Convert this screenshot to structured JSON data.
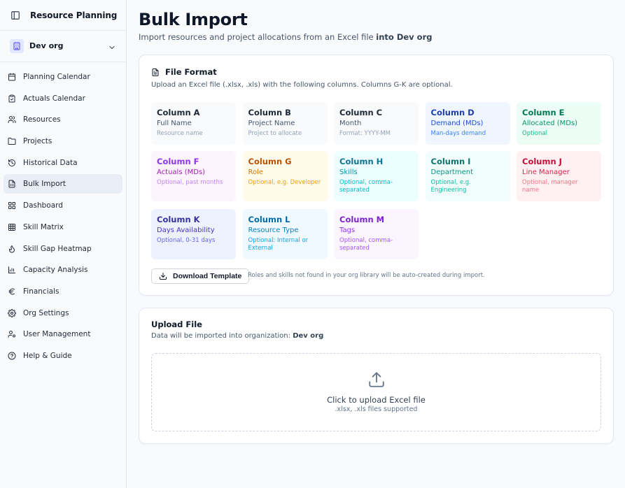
{
  "app": {
    "title": "Resource Planning"
  },
  "org": {
    "name": "Dev org"
  },
  "nav": [
    {
      "label": "Planning Calendar",
      "icon": "calendar-icon"
    },
    {
      "label": "Actuals Calendar",
      "icon": "clipboard-icon"
    },
    {
      "label": "Resources",
      "icon": "users-icon"
    },
    {
      "label": "Projects",
      "icon": "folder-icon"
    },
    {
      "label": "Historical Data",
      "icon": "history-icon"
    },
    {
      "label": "Bulk Import",
      "icon": "file-spreadsheet-icon",
      "active": true
    },
    {
      "label": "Dashboard",
      "icon": "dashboard-icon"
    },
    {
      "label": "Skill Matrix",
      "icon": "grid-icon"
    },
    {
      "label": "Skill Gap Heatmap",
      "icon": "flame-icon"
    },
    {
      "label": "Capacity Analysis",
      "icon": "bar-chart-icon"
    },
    {
      "label": "Financials",
      "icon": "euro-icon"
    },
    {
      "label": "Org Settings",
      "icon": "gear-icon"
    },
    {
      "label": "User Management",
      "icon": "user-cog-icon"
    },
    {
      "label": "Help & Guide",
      "icon": "help-circle-icon"
    }
  ],
  "page": {
    "title": "Bulk Import",
    "subtitle_prefix": "Import resources and project allocations from an Excel file ",
    "subtitle_bold": "into Dev org"
  },
  "file_format": {
    "title": "File Format",
    "description": "Upload an Excel file (.xlsx, .xls) with the following columns. Columns G-K are optional.",
    "columns": [
      {
        "name": "Column A",
        "field": "Full Name",
        "desc": "Resource name",
        "bg": "#f8fafc",
        "c1": "#1f2937",
        "c2": "#475569",
        "c3": "#94a3b8"
      },
      {
        "name": "Column B",
        "field": "Project Name",
        "desc": "Project to allocate",
        "bg": "#f8fafc",
        "c1": "#1f2937",
        "c2": "#475569",
        "c3": "#94a3b8"
      },
      {
        "name": "Column C",
        "field": "Month",
        "desc": "Format: YYYY-MM",
        "bg": "#f8fafc",
        "c1": "#1f2937",
        "c2": "#475569",
        "c3": "#94a3b8"
      },
      {
        "name": "Column D",
        "field": "Demand (MDs)",
        "desc": "Man-days demand",
        "bg": "#eff6ff",
        "c1": "#1e40af",
        "c2": "#1d4ed8",
        "c3": "#3b82f6"
      },
      {
        "name": "Column E",
        "field": "Allocated (MDs)",
        "desc": "Optional",
        "bg": "#ecfdf5",
        "c1": "#047857",
        "c2": "#059669",
        "c3": "#10b981"
      },
      {
        "name": "Column F",
        "field": "Actuals (MDs)",
        "desc": "Optional, past months",
        "bg": "#fdf4ff",
        "c1": "#9333ea",
        "c2": "#a21caf",
        "c3": "#c084fc"
      },
      {
        "name": "Column G",
        "field": "Role",
        "desc": "Optional, e.g. Developer",
        "bg": "#fffbeb",
        "c1": "#b45309",
        "c2": "#d97706",
        "c3": "#f59e0b"
      },
      {
        "name": "Column H",
        "field": "Skills",
        "desc": "Optional, comma-separated",
        "bg": "#ecfeff",
        "c1": "#0e7490",
        "c2": "#0891b2",
        "c3": "#06b6d4"
      },
      {
        "name": "Column I",
        "field": "Department",
        "desc": "Optional, e.g. Engineering",
        "bg": "#f0fdfa",
        "c1": "#0f766e",
        "c2": "#0d9488",
        "c3": "#14b8a6"
      },
      {
        "name": "Column J",
        "field": "Line Manager",
        "desc": "Optional, manager name",
        "bg": "#fff1f2",
        "c1": "#be123c",
        "c2": "#e11d48",
        "c3": "#fb7185"
      },
      {
        "name": "Column K",
        "field": "Days Availability",
        "desc": "Optional, 0-31 days",
        "bg": "#eef2ff",
        "c1": "#3730a3",
        "c2": "#4338ca",
        "c3": "#6366f1"
      },
      {
        "name": "Column L",
        "field": "Resource Type",
        "desc": "Optional: Internal or External",
        "bg": "#f0f9ff",
        "c1": "#0369a1",
        "c2": "#0284c7",
        "c3": "#0ea5e9"
      },
      {
        "name": "Column M",
        "field": "Tags",
        "desc": "Optional, comma-separated",
        "bg": "#faf5ff",
        "c1": "#7e22ce",
        "c2": "#9333ea",
        "c3": "#a855f7"
      }
    ],
    "download_label": "Download Template",
    "download_note": "Roles and skills not found in your org library will be auto-created during import."
  },
  "upload": {
    "title": "Upload File",
    "desc_prefix": "Data will be imported into organization: ",
    "desc_bold": "Dev org",
    "drop_main": "Click to upload Excel file",
    "drop_sub": ".xlsx, .xls files supported"
  }
}
